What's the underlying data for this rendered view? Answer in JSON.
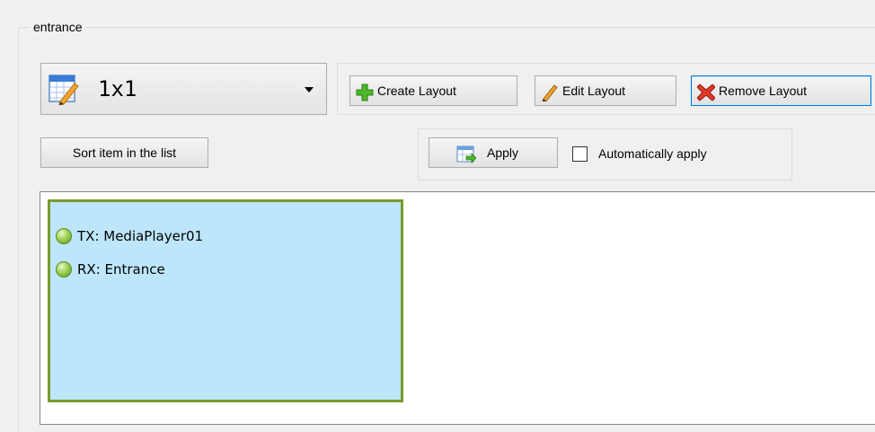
{
  "group": {
    "title": "entrance"
  },
  "layout_select": {
    "value": "1x1",
    "icon": "layout-edit-icon"
  },
  "toolbar": {
    "create_label": "Create Layout",
    "edit_label": "Edit Layout",
    "remove_label": "Remove Layout"
  },
  "sort_button": {
    "label": "Sort item in the list"
  },
  "apply": {
    "label": "Apply",
    "auto_label": "Automatically apply",
    "auto_checked": false
  },
  "cell": {
    "items": [
      {
        "label": "TX: MediaPlayer01",
        "status": "online"
      },
      {
        "label": "RX: Entrance",
        "status": "online"
      }
    ]
  },
  "colors": {
    "cell_fill": "#bde6fb",
    "cell_border": "#7a9a2a",
    "status_green": "#a4d65e",
    "focus_blue": "#0078d7"
  }
}
